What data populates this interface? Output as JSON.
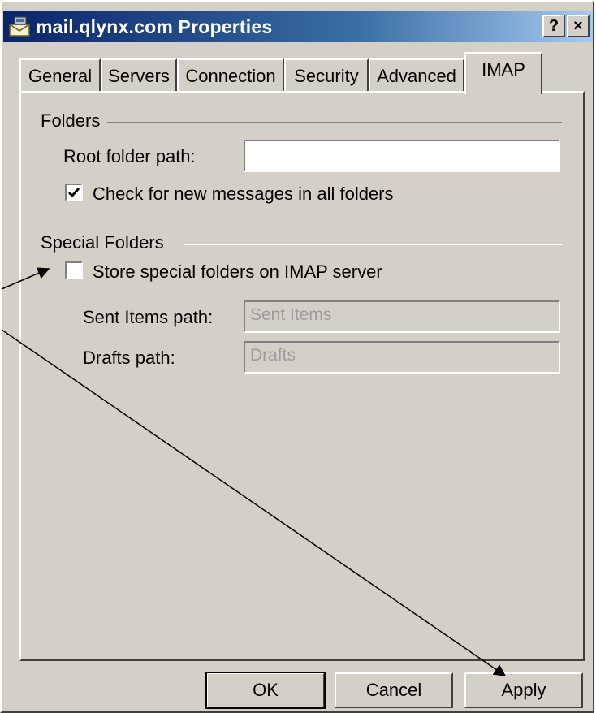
{
  "window": {
    "title": "mail.qlynx.com Properties",
    "icon": "mail-server-icon",
    "help_label": "?",
    "close_label": "×"
  },
  "tabs": [
    {
      "label": "General",
      "active": false
    },
    {
      "label": "Servers",
      "active": false
    },
    {
      "label": "Connection",
      "active": false
    },
    {
      "label": "Security",
      "active": false
    },
    {
      "label": "Advanced",
      "active": false
    },
    {
      "label": "IMAP",
      "active": true
    }
  ],
  "folders_group": {
    "title": "Folders",
    "root_folder_label": "Root folder path:",
    "root_folder_value": "",
    "check_all_label": "Check for new messages in all folders",
    "check_all_checked": true
  },
  "special_folders_group": {
    "title": "Special Folders",
    "store_label": "Store special folders on IMAP server",
    "store_checked": false,
    "sent_items_label": "Sent Items path:",
    "sent_items_value": "Sent Items",
    "drafts_label": "Drafts path:",
    "drafts_value": "Drafts"
  },
  "buttons": {
    "ok": "OK",
    "cancel": "Cancel",
    "apply": "Apply"
  },
  "colors": {
    "dialog_face": "#d4d0c8",
    "title_start": "#0a246a",
    "title_end": "#a6caf0",
    "disabled_text": "#9c9c9c"
  }
}
